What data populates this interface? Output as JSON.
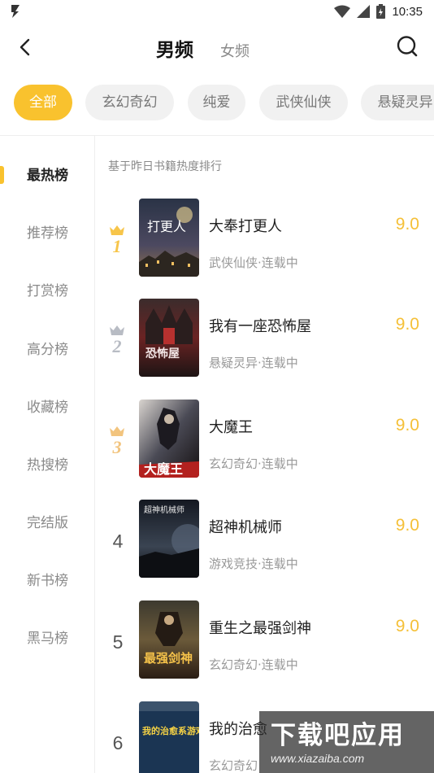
{
  "status_bar": {
    "time": "10:35",
    "icons": [
      "app-notification-icon",
      "wifi-icon",
      "signal-icon",
      "battery-icon"
    ]
  },
  "header": {
    "title": "男频",
    "alt_tab": "女频",
    "icons": [
      "back-arrow-icon",
      "search-icon"
    ]
  },
  "categories": [
    {
      "label": "全部",
      "active": true
    },
    {
      "label": "玄幻奇幻",
      "active": false
    },
    {
      "label": "纯爱",
      "active": false
    },
    {
      "label": "武侠仙侠",
      "active": false
    },
    {
      "label": "悬疑灵异",
      "active": false
    }
  ],
  "sidebar": {
    "items": [
      {
        "label": "最热榜",
        "active": true
      },
      {
        "label": "推荐榜",
        "active": false
      },
      {
        "label": "打赏榜",
        "active": false
      },
      {
        "label": "高分榜",
        "active": false
      },
      {
        "label": "收藏榜",
        "active": false
      },
      {
        "label": "热搜榜",
        "active": false
      },
      {
        "label": "完结版",
        "active": false
      },
      {
        "label": "新书榜",
        "active": false
      },
      {
        "label": "黑马榜",
        "active": false
      }
    ]
  },
  "ranking": {
    "subtitle": "基于昨日书籍热度排行",
    "books": [
      {
        "rank": "1",
        "title": "大奉打更人",
        "meta": "武侠仙侠·连载中",
        "score": "9.0",
        "cover_text": "打更人"
      },
      {
        "rank": "2",
        "title": "我有一座恐怖屋",
        "meta": "悬疑灵异·连载中",
        "score": "9.0",
        "cover_text": "恐怖屋"
      },
      {
        "rank": "3",
        "title": "大魔王",
        "meta": "玄幻奇幻·连载中",
        "score": "9.0",
        "cover_text": "大魔王"
      },
      {
        "rank": "4",
        "title": "超神机械师",
        "meta": "游戏竞技·连载中",
        "score": "9.0",
        "cover_text": "超神机械师"
      },
      {
        "rank": "5",
        "title": "重生之最强剑神",
        "meta": "玄幻奇幻·连载中",
        "score": "9.0",
        "cover_text": "最强剑神"
      },
      {
        "rank": "6",
        "title": "我的治愈",
        "meta": "玄幻奇幻",
        "score": "",
        "cover_text": "我的治愈系游戏"
      }
    ]
  },
  "colors": {
    "accent": "#f9c22e",
    "score": "#f5c038",
    "gold_crown": "#f7c54a",
    "silver_crown": "#b8bcc4",
    "bronze_crown": "#f2c47e"
  },
  "watermark": {
    "main": "下载吧应用",
    "url": "www.xiazaiba.com"
  }
}
